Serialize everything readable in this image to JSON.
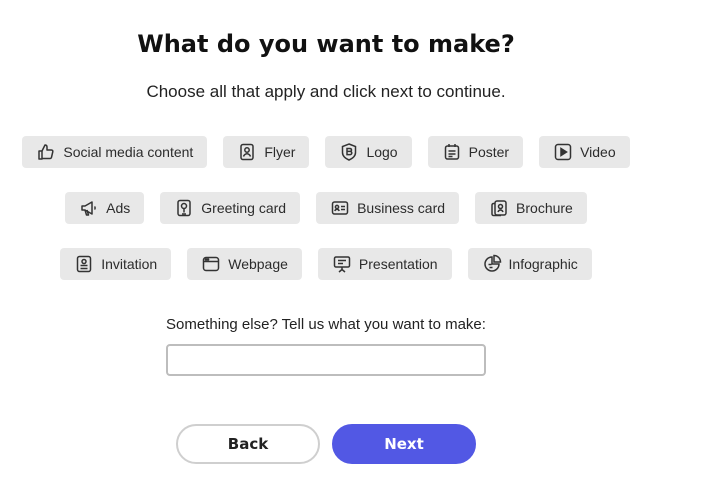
{
  "header": {
    "title": "What do you want to make?",
    "subtitle": "Choose all that apply and click next to continue."
  },
  "options": {
    "row1": [
      {
        "label": "Social media content",
        "icon": "thumbs-up-icon"
      },
      {
        "label": "Flyer",
        "icon": "flyer-icon"
      },
      {
        "label": "Logo",
        "icon": "logo-badge-icon"
      },
      {
        "label": "Poster",
        "icon": "poster-icon"
      },
      {
        "label": "Video",
        "icon": "video-play-icon"
      }
    ],
    "row2": [
      {
        "label": "Ads",
        "icon": "megaphone-icon"
      },
      {
        "label": "Greeting card",
        "icon": "greeting-card-icon"
      },
      {
        "label": "Business card",
        "icon": "business-card-icon"
      },
      {
        "label": "Brochure",
        "icon": "brochure-icon"
      }
    ],
    "row3": [
      {
        "label": "Invitation",
        "icon": "invitation-icon"
      },
      {
        "label": "Webpage",
        "icon": "webpage-icon"
      },
      {
        "label": "Presentation",
        "icon": "presentation-icon"
      },
      {
        "label": "Infographic",
        "icon": "infographic-icon"
      }
    ]
  },
  "custom": {
    "prompt": "Something else? Tell us what you want to make:",
    "value": "",
    "placeholder": ""
  },
  "buttons": {
    "back": "Back",
    "next": "Next"
  },
  "colors": {
    "chip_bg": "#e8e8e8",
    "primary": "#5258e4"
  }
}
